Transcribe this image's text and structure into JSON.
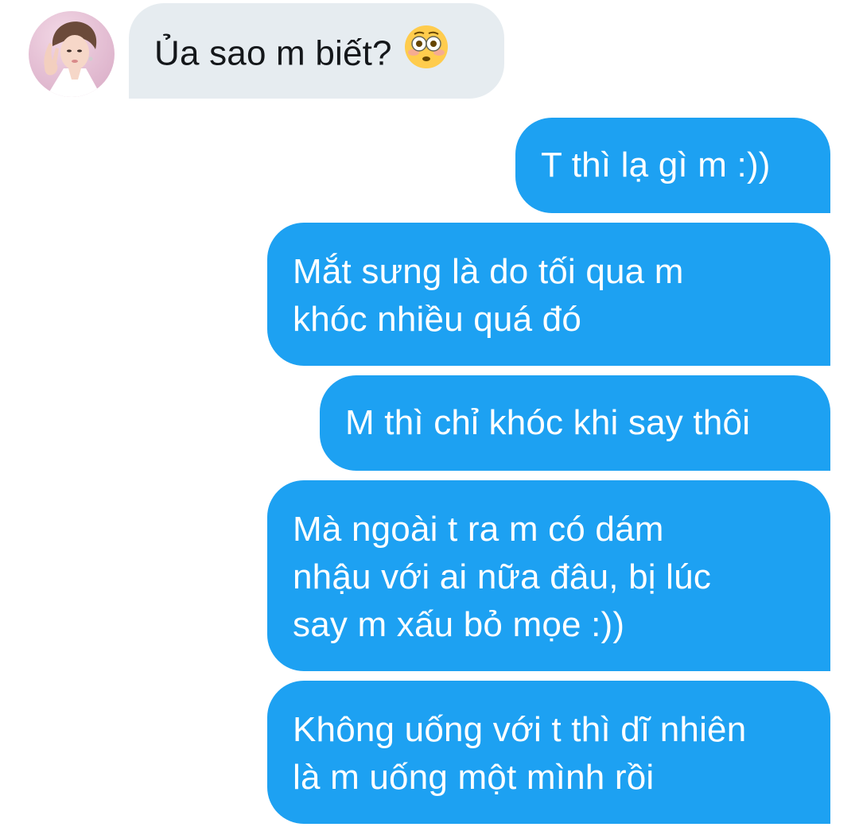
{
  "conversation": {
    "contact": {
      "avatar_icon": "avatar-photo"
    },
    "messages": [
      {
        "sender": "them",
        "lines": [
          "Ủa sao m biết?"
        ],
        "emoji": "flushed-face-emoji"
      },
      {
        "sender": "me",
        "lines": [
          "T thì lạ gì m :))"
        ]
      },
      {
        "sender": "me",
        "lines": [
          "Mắt sưng là do tối qua m",
          "khóc nhiều quá đó"
        ]
      },
      {
        "sender": "me",
        "lines": [
          "M thì chỉ khóc khi say thôi"
        ]
      },
      {
        "sender": "me",
        "lines": [
          "Mà ngoài t ra m có dám",
          "nhậu với ai nữa đâu, bị lúc",
          "say m xấu bỏ mọe :))"
        ]
      },
      {
        "sender": "me",
        "lines": [
          "Không uống với t thì dĩ nhiên",
          "là m uống một mình rồi"
        ]
      }
    ]
  },
  "colors": {
    "incoming_bubble": "#e6ecf0",
    "outgoing_bubble": "#1da1f2",
    "incoming_text": "#14171a",
    "outgoing_text": "#ffffff"
  }
}
